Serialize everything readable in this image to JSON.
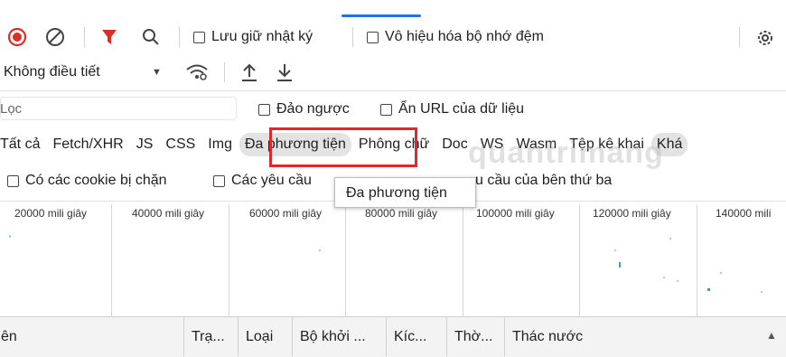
{
  "toolbar": {
    "preserve_log_label": "Lưu giữ nhật ký",
    "disable_cache_label": "Vô hiệu hóa bộ nhớ đệm"
  },
  "throttle": {
    "value": "Không điều tiết"
  },
  "filter": {
    "placeholder": "Lọc",
    "invert_label": "Đảo ngược",
    "hide_data_urls_label": "Ẩn URL của dữ liệu"
  },
  "types": [
    "Tất cả",
    "Fetch/XHR",
    "JS",
    "CSS",
    "Img",
    "Đa phương tiện",
    "Phông chữ",
    "Doc",
    "WS",
    "Wasm",
    "Tệp kê khai",
    "Khá"
  ],
  "cookies": {
    "blocked_cookies_label": "Có các cookie bị chặn",
    "blocked_requests_label": "Các yêu cầu",
    "third_party_label": "u cầu của bên thứ ba"
  },
  "tooltip": {
    "text": "Đa phương tiện"
  },
  "timeline": {
    "ticks": [
      "20000 mili giây",
      "40000 mili giây",
      "60000 mili giây",
      "80000 mili giây",
      "100000 mili giây",
      "120000 mili giây",
      "140000 mili"
    ]
  },
  "columns": [
    "ên",
    "Trạ...",
    "Loại",
    "Bộ khởi ...",
    "Kíc...",
    "Thờ...",
    "Thác nước"
  ],
  "watermark": "quantrimang",
  "colors": {
    "record": "#d93025",
    "filter_active": "#d93025",
    "highlight_box": "#e3262b",
    "tab_indicator": "#1a73e8"
  }
}
